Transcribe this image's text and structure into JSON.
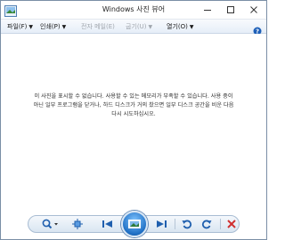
{
  "window": {
    "title": "Windows 사진 뷰어"
  },
  "menu": {
    "file": "파일(F)",
    "print": "인쇄(P)",
    "email": "전자 메일(E)",
    "burn": "굽기(U)",
    "open": "열기(O)"
  },
  "content": {
    "message_line1": "이 사진을 표시할 수 없습니다. 사용할 수 있는 메모리가 부족할 수 있습니다. 사용 중이",
    "message_line2": "아닌 일부 프로그램을 닫거나, 하드 디스크가 거의 찼으면 일부 디스크 공간을 비운 다음",
    "message_line3": "다시 시도하십시오."
  },
  "icons": {
    "app": "photo-viewer-icon",
    "minimize": "minimize-icon",
    "maximize": "maximize-icon",
    "close": "close-icon",
    "help": "help-icon",
    "zoom": "zoom-icon",
    "fit": "actual-size-icon",
    "prev": "previous-icon",
    "slideshow": "slideshow-icon",
    "next": "next-icon",
    "rotate_left": "rotate-counterclockwise-icon",
    "rotate_right": "rotate-clockwise-icon",
    "delete": "delete-icon"
  },
  "colors": {
    "accent": "#1f6fc4",
    "delete": "#d03030",
    "help": "#1d5fb8"
  }
}
